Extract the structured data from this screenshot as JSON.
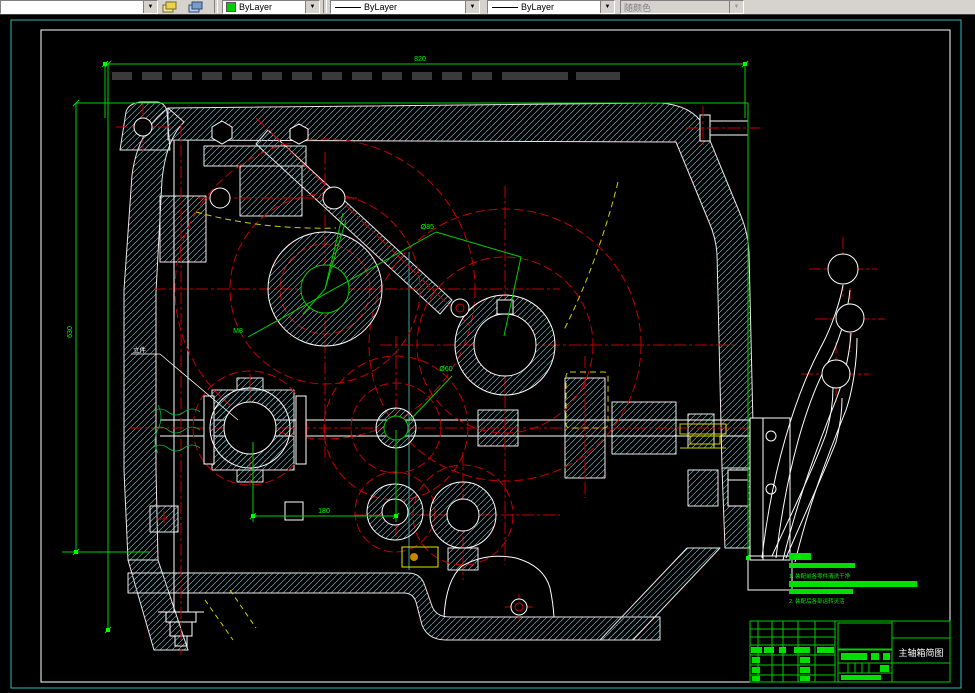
{
  "toolbar": {
    "color_value": "ByLayer",
    "linetype_value": "ByLayer",
    "lineweight_value": "ByLayer",
    "plot_style_value": "随颜色"
  },
  "drawing": {
    "dim_top": "820",
    "dim_left": "630",
    "dim_bottom": "180",
    "leader_a": "Ø85",
    "leader_b": "M8",
    "leader_c": "Ø60",
    "part_label": "立件",
    "note_line_1": "1. 装配前各零件清洗干净",
    "note_line_2": "2. 装配后各部运转灵活",
    "title": "主轴箱简图"
  }
}
